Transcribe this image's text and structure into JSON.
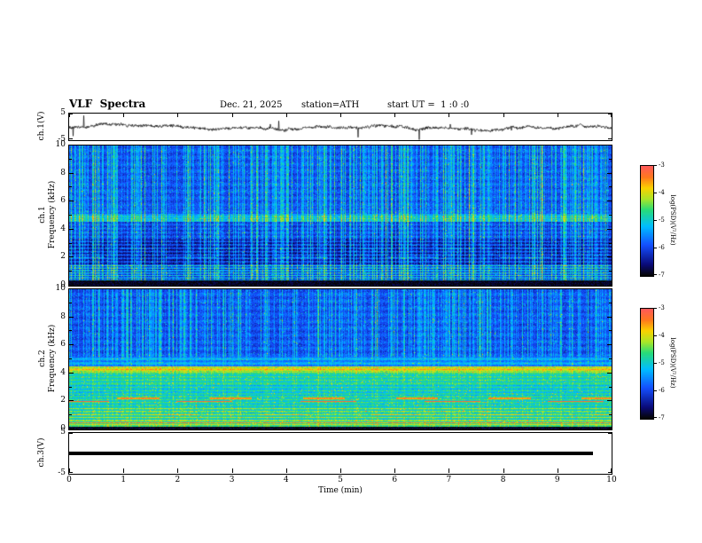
{
  "header": {
    "title": "VLF  Spectra",
    "date": "Dec. 21, 2025",
    "station": "station=ATH",
    "start_ut": "start UT =  1 :0 :0"
  },
  "xaxis": {
    "label": "Time (min)",
    "range": [
      0,
      10
    ],
    "ticks": [
      0,
      1,
      2,
      3,
      4,
      5,
      6,
      7,
      8,
      9,
      10
    ]
  },
  "colormap": [
    {
      "t": 0.0,
      "c": [
        5,
        5,
        5
      ]
    },
    {
      "t": 0.1,
      "c": [
        10,
        10,
        120
      ]
    },
    {
      "t": 0.28,
      "c": [
        20,
        80,
        255
      ]
    },
    {
      "t": 0.45,
      "c": [
        0,
        190,
        255
      ]
    },
    {
      "t": 0.6,
      "c": [
        40,
        220,
        120
      ]
    },
    {
      "t": 0.7,
      "c": [
        170,
        230,
        40
      ]
    },
    {
      "t": 0.8,
      "c": [
        250,
        210,
        0
      ]
    },
    {
      "t": 0.9,
      "c": [
        255,
        120,
        30
      ]
    },
    {
      "t": 1.0,
      "c": [
        255,
        90,
        90
      ]
    }
  ],
  "chart_data": [
    {
      "panel": "ch.1 voltage time series",
      "type": "line",
      "ylabel": "ch.1(V)",
      "ylim": [
        -5,
        5
      ],
      "yticks": [
        5,
        -5
      ],
      "x_range": [
        0,
        10
      ],
      "line_color": "#000000",
      "noise_amp_v": 0.5,
      "wander": 0.1,
      "spike_prob": 0.007,
      "spike_max_v": 4.2,
      "summary": "broadband noise about 0 V with impulsive spikes up to roughly ±4 V across the full 0-10 min record"
    },
    {
      "panel": "ch.1 spectrogram",
      "type": "heatmap",
      "ylabel_ch": "ch.1",
      "ylabel_main": "Frequency (kHz)",
      "ylim": [
        0,
        10
      ],
      "yticks": [
        0,
        2,
        4,
        6,
        8,
        10
      ],
      "x_range": [
        0,
        10
      ],
      "colorbar": {
        "label": "log(PSD)(V²/Hz)",
        "ticks": [
          -3,
          -4,
          -5,
          -6,
          -7
        ],
        "range": [
          -7,
          -3
        ]
      },
      "summary": "blue broadband background (~ -6) with dense bright vertical sferic streaks, banded structure 0.4-3.3 kHz, brighter cyan band near 4.6-5.1 kHz and black band below 0.35 kHz",
      "bands": [
        {
          "f": [
            0,
            0.35
          ],
          "base": -6.92,
          "stripe": 0.05,
          "k": 60
        },
        {
          "f": [
            0.35,
            1.45
          ],
          "base": -5.8,
          "stripe": 0.6,
          "k": 36,
          "phase": 0.5
        },
        {
          "f": [
            1.45,
            3.3
          ],
          "base": -6.35,
          "stripe": 0.38,
          "k": 26,
          "phase": 1.2
        },
        {
          "f": [
            3.3,
            4.55
          ],
          "base": -6.1,
          "stripe": 0.18,
          "k": 22
        },
        {
          "f": [
            4.55,
            5.1
          ],
          "base": -5.4,
          "stripe": 0.2,
          "k": 22
        },
        {
          "f": [
            5.1,
            10
          ],
          "base": -6.0,
          "stripe": 0.13,
          "k": 13,
          "phase": 2
        }
      ],
      "lines": [
        {
          "f": 4.78,
          "w": 0.06,
          "boost": 0.55
        },
        {
          "f": 2.02,
          "w": 0.05,
          "boost": 0.5,
          "dash": 0.05,
          "phase": 1.0
        },
        {
          "f": 2.62,
          "w": 0.045,
          "boost": 0.4,
          "dash": 0.07,
          "phase": 2.5
        },
        {
          "f": 5.55,
          "w": 0.05,
          "boost": 0.3
        }
      ],
      "streaks": {
        "tail": 2.5,
        "strong_prob": 0.05,
        "strong_add": 1.1,
        "split_f": 0,
        "weight_hi": 0.6,
        "weight_lo": 0.6
      }
    },
    {
      "panel": "ch.2 spectrogram",
      "type": "heatmap",
      "ylabel_ch": "ch.2",
      "ylabel_main": "Frequency (kHz)",
      "ylim": [
        0,
        10
      ],
      "yticks": [
        0,
        2,
        4,
        6,
        8,
        10
      ],
      "x_range": [
        0,
        10
      ],
      "colorbar": {
        "label": "log(PSD)(V²/Hz)",
        "ticks": [
          -3,
          -4,
          -5,
          -6,
          -7
        ],
        "range": [
          -7,
          -3
        ]
      },
      "summary": "blue with vertical streaks above ~5 kHz; strong green/yellow banded power below 5 kHz, yellow band near 4.1-4.5 kHz, intermittent orange-red line segments near 2 kHz, black line at the bottom edge",
      "bands": [
        {
          "f": [
            0,
            0.18
          ],
          "base": -6.92,
          "stripe": 0.05,
          "k": 60
        },
        {
          "f": [
            0.18,
            0.62
          ],
          "base": -4.55,
          "stripe": 0.55,
          "k": 42,
          "phase": 0.3
        },
        {
          "f": [
            0.62,
            1.6
          ],
          "base": -4.75,
          "stripe": 0.45,
          "k": 30,
          "phase": 1.1
        },
        {
          "f": [
            1.6,
            2.4
          ],
          "base": -4.95,
          "stripe": 0.3,
          "k": 30,
          "phase": 0.4
        },
        {
          "f": [
            2.4,
            3.2
          ],
          "base": -5.05,
          "stripe": 0.3,
          "k": 27,
          "phase": 2.2
        },
        {
          "f": [
            3.2,
            4.05
          ],
          "base": -4.9,
          "stripe": 0.25,
          "k": 27,
          "phase": 0.9
        },
        {
          "f": [
            4.05,
            4.5
          ],
          "base": -4.25,
          "stripe": 0.2,
          "k": 27
        },
        {
          "f": [
            4.5,
            5.2
          ],
          "base": -5.5,
          "stripe": 0.25,
          "k": 20,
          "phase": 1.6
        },
        {
          "f": [
            5.2,
            10
          ],
          "base": -6.0,
          "stripe": 0.13,
          "k": 13,
          "phase": 2
        }
      ],
      "lines": [
        {
          "f": 4.28,
          "w": 0.07,
          "boost": 0.35
        },
        {
          "f": 2.0,
          "w": 0.05,
          "set": -3.35,
          "dash": 0.045,
          "phase": 1.0
        },
        {
          "f": 2.22,
          "w": 0.04,
          "set": -3.6,
          "dash": 0.06,
          "phase": 3.2
        },
        {
          "f": 1.05,
          "w": 0.04,
          "boost": 0.45,
          "dash": 0.05,
          "phase": 2.0
        },
        {
          "f": 0.45,
          "w": 0.04,
          "boost": 0.35
        }
      ],
      "streaks": {
        "tail": 2.2,
        "strong_prob": 0.04,
        "strong_add": 1.0,
        "split_f": 5.2,
        "weight_hi": 0.55,
        "weight_lo": 0.18
      }
    },
    {
      "panel": "ch.3 voltage time series",
      "type": "line",
      "ylabel": "ch.3(V)",
      "ylim": [
        -5,
        5
      ],
      "yticks": [
        5,
        -5
      ],
      "value_v": 0,
      "x_end_min": 9.65,
      "thickness_px": 4,
      "line_color": "#000000",
      "summary": "constant flat line at 0 V ending near 9.65 min"
    }
  ]
}
